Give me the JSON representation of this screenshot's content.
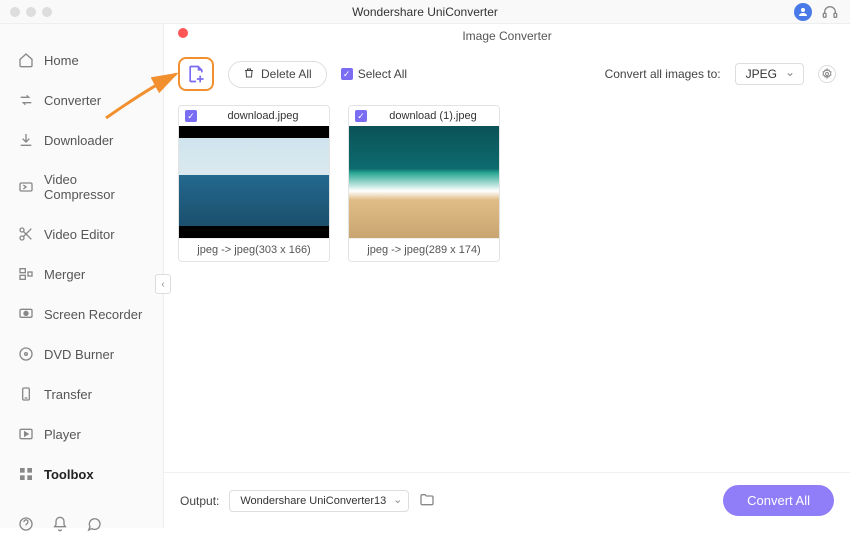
{
  "app_title": "Wondershare UniConverter",
  "panel_title": "Image Converter",
  "sidebar": {
    "items": [
      {
        "label": "Home"
      },
      {
        "label": "Converter"
      },
      {
        "label": "Downloader"
      },
      {
        "label": "Video Compressor"
      },
      {
        "label": "Video Editor"
      },
      {
        "label": "Merger"
      },
      {
        "label": "Screen Recorder"
      },
      {
        "label": "DVD Burner"
      },
      {
        "label": "Transfer"
      },
      {
        "label": "Player"
      },
      {
        "label": "Toolbox"
      }
    ],
    "active_index": 10
  },
  "toolbar": {
    "delete_all_label": "Delete All",
    "select_all_label": "Select All",
    "convert_to_label": "Convert all images to:",
    "format_selected": "JPEG"
  },
  "images": [
    {
      "filename": "download.jpeg",
      "conversion_info": "jpeg -> jpeg(303 x 166)",
      "checked": true
    },
    {
      "filename": "download (1).jpeg",
      "conversion_info": "jpeg -> jpeg(289 x 174)",
      "checked": true
    }
  ],
  "output": {
    "label": "Output:",
    "path_selected": "Wondershare UniConverter13"
  },
  "convert_all_label": "Convert All",
  "annotation": {
    "highlight_color": "#f29030"
  }
}
